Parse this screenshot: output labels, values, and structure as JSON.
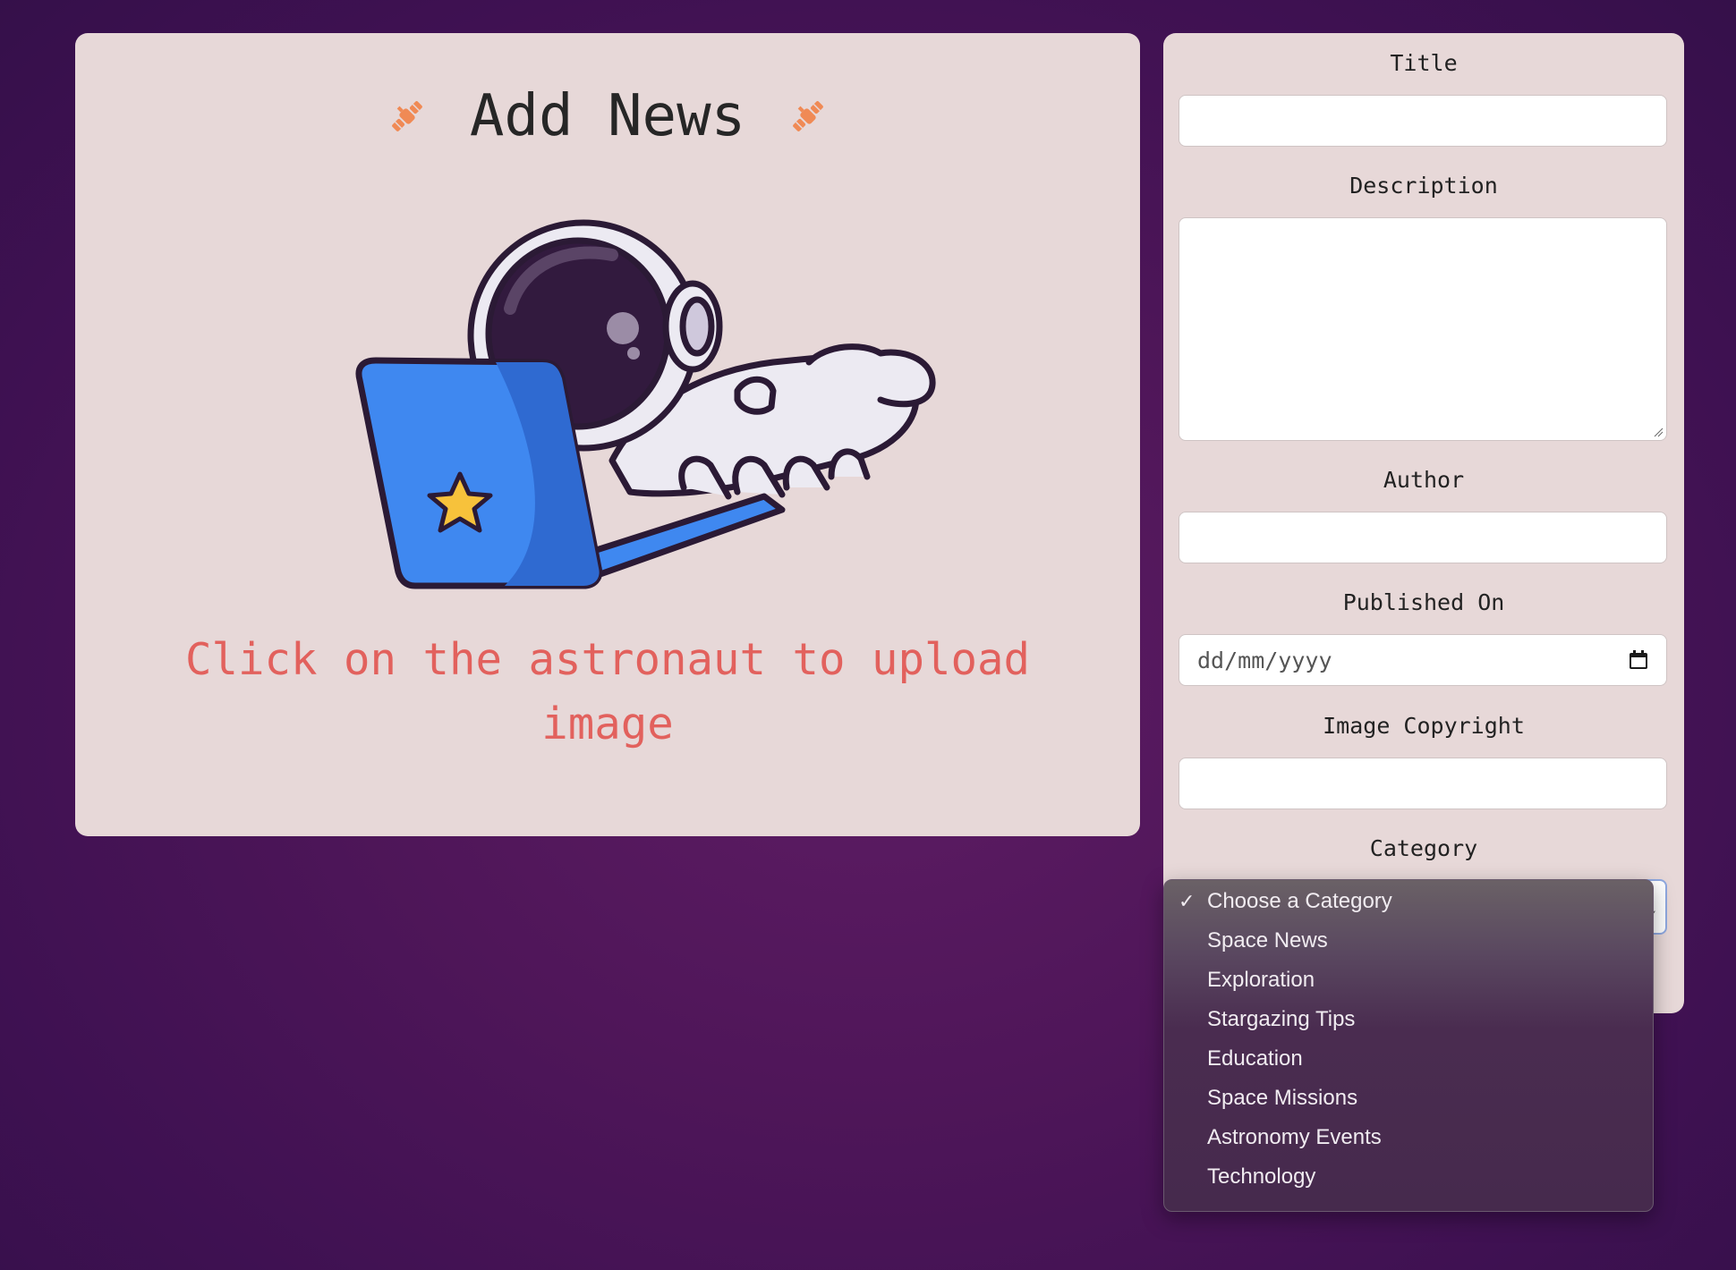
{
  "upload_panel": {
    "title": "Add News",
    "left_icon": "satellite-icon",
    "right_icon": "satellite-icon",
    "illustration": "astronaut-laptop-illustration",
    "hint": "Click on the astronaut to upload image"
  },
  "form": {
    "title_label": "Title",
    "title_value": "",
    "description_label": "Description",
    "description_value": "",
    "author_label": "Author",
    "author_value": "",
    "published_label": "Published On",
    "published_placeholder": "dd/mm/yyyy",
    "copyright_label": "Image Copyright",
    "copyright_value": "",
    "category_label": "Category"
  },
  "category_dropdown": {
    "selected": "Choose a Category",
    "options": [
      "Choose a Category",
      "Space News",
      "Exploration",
      "Stargazing Tips",
      "Education",
      "Space Missions",
      "Astronomy Events",
      "Technology"
    ]
  },
  "colors": {
    "background": "#4f1659",
    "card": "#e7d8d8",
    "accent": "#e2615d",
    "icon_orange": "#f08a55",
    "laptop_blue": "#3f88f0"
  }
}
